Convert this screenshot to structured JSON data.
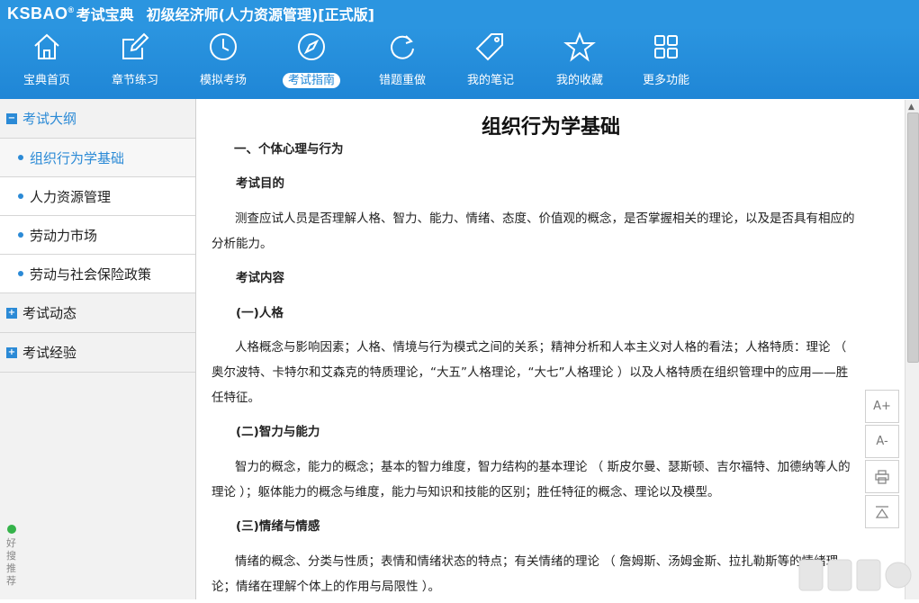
{
  "header": {
    "logo": "KSBAO",
    "logo_mark": "®",
    "logo_cn": "考试宝典",
    "app_title": "初级经济师(人力资源管理)[正式版]"
  },
  "nav": [
    {
      "label": "宝典首页",
      "icon": "home-icon"
    },
    {
      "label": "章节练习",
      "icon": "edit-icon"
    },
    {
      "label": "模拟考场",
      "icon": "clock-icon"
    },
    {
      "label": "考试指南",
      "icon": "compass-icon",
      "active": true
    },
    {
      "label": "错题重做",
      "icon": "refresh-icon"
    },
    {
      "label": "我的笔记",
      "icon": "tag-icon"
    },
    {
      "label": "我的收藏",
      "icon": "star-icon"
    },
    {
      "label": "更多功能",
      "icon": "grid-icon"
    }
  ],
  "sidebar": {
    "cat1": "考试大纲",
    "items": [
      "组织行为学基础",
      "人力资源管理",
      "劳动力市场",
      "劳动与社会保险政策"
    ],
    "cat2": "考试动态",
    "cat3": "考试经验",
    "open_mark": "−",
    "closed_mark": "+"
  },
  "haosou": "好搜推荐",
  "doc": {
    "title": "组织行为学基础",
    "s1": "一、个体心理与行为",
    "s2": "考试目的",
    "p1": "测查应试人员是否理解人格、智力、能力、情绪、态度、价值观的概念，是否掌握相关的理论，以及是否具有相应的分析能力。",
    "s3": "考试内容",
    "s4": "(一)人格",
    "p2": "人格概念与影响因素；人格、情境与行为模式之间的关系；精神分析和人本主义对人格的看法；人格特质：理论 （ 奥尔波特、卡特尔和艾森克的特质理论，“大五”人格理论，“大七”人格理论 ）以及人格特质在组织管理中的应用——胜任特征。",
    "s5": "(二)智力与能力",
    "p3": "智力的概念，能力的概念；基本的智力维度，智力结构的基本理论 （ 斯皮尔曼、瑟斯顿、吉尔福特、加德纳等人的理论 ）；躯体能力的概念与维度，能力与知识和技能的区别；胜任特征的概念、理论以及模型。",
    "s6": "(三)情绪与情感",
    "p4": "情绪的概念、分类与性质；表情和情绪状态的特点；有关情绪的理论 （ 詹姆斯、汤姆金斯、拉扎勒斯等的情绪理论；情绪在理解个体上的作用与局限性 ）。"
  },
  "tools": {
    "font_up": "A+",
    "font_down": "A-",
    "print": "print-icon",
    "top": "back-to-top-icon"
  },
  "colors": {
    "accent": "#2b95e0",
    "link": "#2b8ad6"
  }
}
